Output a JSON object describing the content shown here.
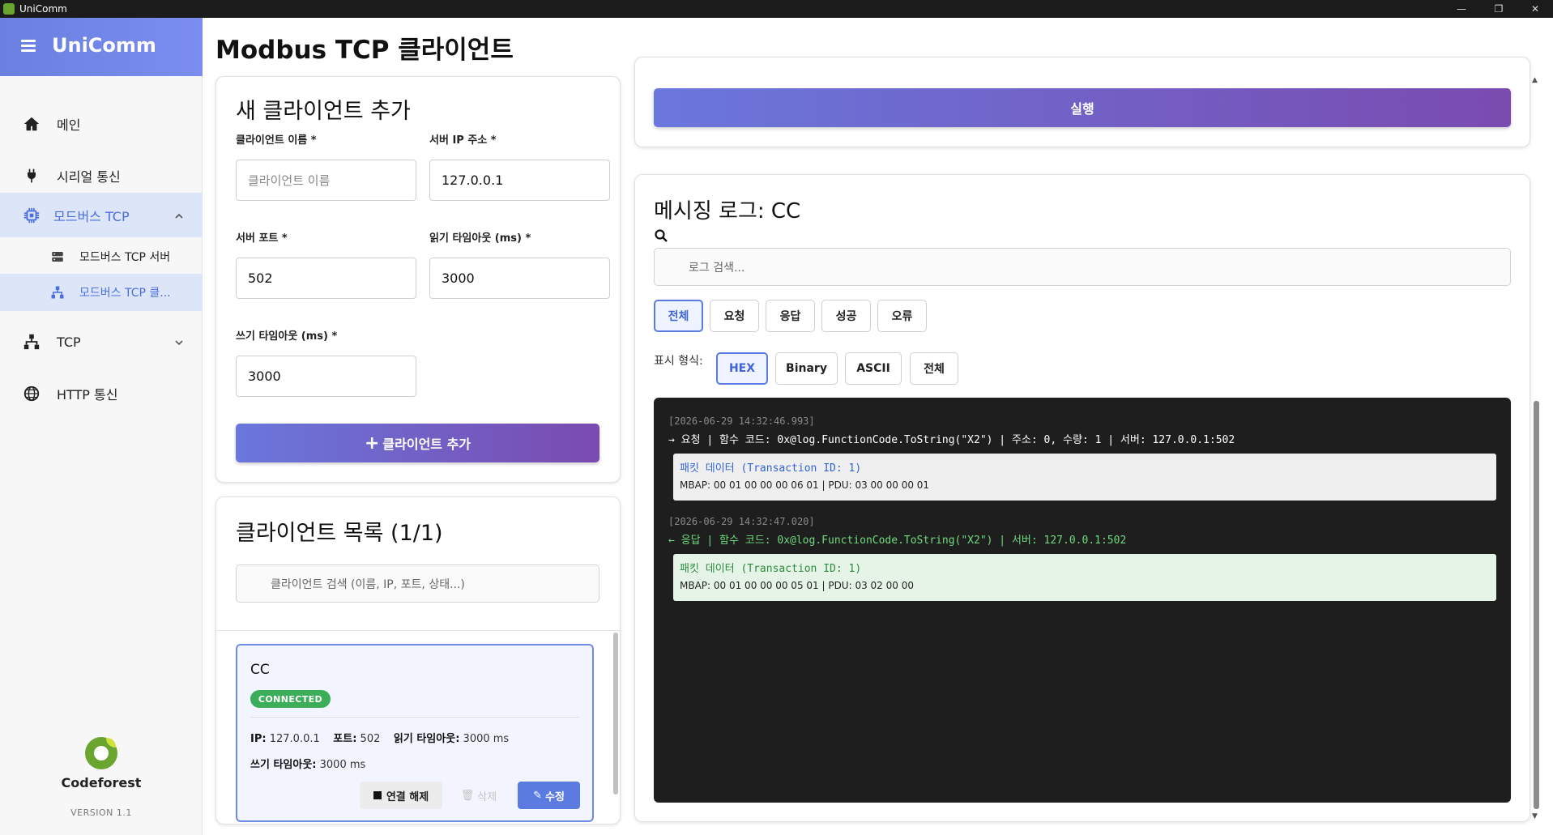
{
  "window": {
    "title": "UniComm"
  },
  "sidebar": {
    "brand": "UniComm",
    "items": [
      {
        "label": "메인"
      },
      {
        "label": "시리얼 통신"
      },
      {
        "label": "모드버스 TCP"
      },
      {
        "label": "모드버스 TCP 서버"
      },
      {
        "label": "모드버스 TCP 클..."
      },
      {
        "label": "TCP"
      },
      {
        "label": "HTTP 통신"
      }
    ],
    "footer_logo": "Codeforest",
    "version": "VERSION 1.1"
  },
  "page": {
    "title": "Modbus TCP 클라이언트"
  },
  "add_client": {
    "title": "새 클라이언트 추가",
    "name_label": "클라이언트 이름 *",
    "name_placeholder": "클라이언트 이름",
    "ip_label": "서버 IP 주소 *",
    "ip_value": "127.0.0.1",
    "port_label": "서버 포트 *",
    "port_value": "502",
    "read_timeout_label": "읽기 타임아웃 (ms) *",
    "read_timeout_value": "3000",
    "write_timeout_label": "쓰기 타임아웃 (ms) *",
    "write_timeout_value": "3000",
    "add_button": "클라이언트 추가"
  },
  "client_list": {
    "title": "클라이언트 목록 (1/1)",
    "search_placeholder": "클라이언트 검색 (이름, IP, 포트, 상태...)",
    "clients": [
      {
        "name": "CC",
        "status": "CONNECTED",
        "ip_label": "IP:",
        "ip": "127.0.0.1",
        "port_label": "포트:",
        "port": "502",
        "read_label": "읽기 타임아웃:",
        "read": "3000 ms",
        "write_label": "쓰기 타임아웃:",
        "write": "3000 ms",
        "disconnect": "연결 해제",
        "delete": "삭제",
        "edit": "수정"
      }
    ]
  },
  "execute": {
    "button": "실행"
  },
  "log": {
    "title": "메시징 로그: CC",
    "search_placeholder": "로그 검색...",
    "filters": [
      "전체",
      "요청",
      "응답",
      "성공",
      "오류"
    ],
    "format_label": "표시 형식:",
    "formats": [
      "HEX",
      "Binary",
      "ASCII",
      "전체"
    ],
    "entries": [
      {
        "timestamp": "[2026-06-29 14:32:46.993]",
        "line": "→ 요청 | 함수 코드: 0x@log.FunctionCode.ToString(\"X2\") | 주소: 0, 수량: 1 | 서버: 127.0.0.1:502",
        "packet_title": "패킷 데이터 (Transaction ID: 1)",
        "packet_data": "MBAP: 00 01 00 00 00 06 01 | PDU: 03 00 00 00 01"
      },
      {
        "timestamp": "[2026-06-29 14:32:47.020]",
        "line": "← 응답 | 함수 코드: 0x@log.FunctionCode.ToString(\"X2\") | 서버: 127.0.0.1:502",
        "packet_title": "패킷 데이터 (Transaction ID: 1)",
        "packet_data": "MBAP: 00 01 00 00 00 05 01 | PDU: 03 02 00 00"
      }
    ]
  },
  "colors": {
    "accent": "#5b7be0",
    "success": "#3cae59",
    "log_bg": "#1e1e1e"
  }
}
